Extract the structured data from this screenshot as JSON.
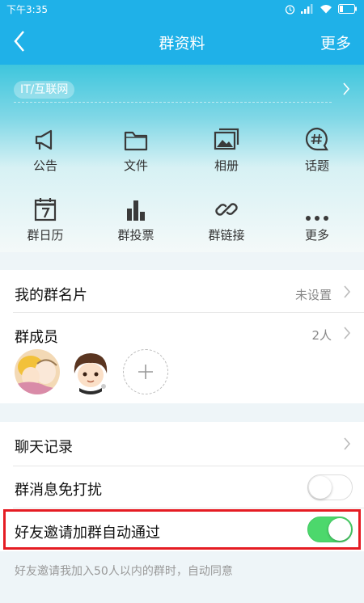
{
  "status_bar": {
    "time": "下午3:35"
  },
  "nav": {
    "title": "群资料",
    "more": "更多"
  },
  "group": {
    "category": "IT/互联网"
  },
  "features": [
    {
      "label": "公告",
      "icon": "megaphone-icon"
    },
    {
      "label": "文件",
      "icon": "folder-icon"
    },
    {
      "label": "相册",
      "icon": "photo-album-icon"
    },
    {
      "label": "话题",
      "icon": "topic-hash-icon"
    },
    {
      "label": "群日历",
      "icon": "calendar-icon"
    },
    {
      "label": "群投票",
      "icon": "bar-chart-icon"
    },
    {
      "label": "群链接",
      "icon": "link-icon"
    },
    {
      "label": "更多",
      "icon": "more-dots-icon"
    }
  ],
  "rows": {
    "card": {
      "title": "我的群名片",
      "value": "未设置"
    },
    "members": {
      "title": "群成员",
      "value": "2人"
    },
    "chat_history": {
      "title": "聊天记录"
    },
    "mute": {
      "title": "群消息免打扰",
      "on": false
    },
    "auto_approve": {
      "title": "好友邀请加群自动通过",
      "on": true
    }
  },
  "footer_note": "好友邀请我加入50人以内的群时，自动同意",
  "colors": {
    "primary": "#1fb1e8",
    "toggle_on": "#4cd86c",
    "highlight": "#e51c23"
  }
}
